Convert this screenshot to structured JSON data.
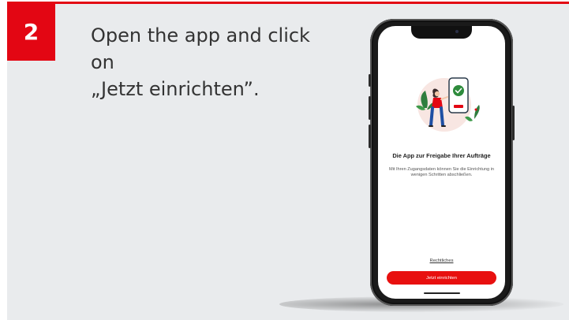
{
  "step": {
    "number": "2"
  },
  "instruction": {
    "line1": "Open the app and click on",
    "line2": "„Jetzt einrichten”."
  },
  "app_screen": {
    "title": "Die App zur Freigabe Ihrer Aufträge",
    "description": "Mit Ihren Zugangsdaten können Sie die Einrichtung in wenigen Schritten abschließen.",
    "legal_link": "Rechtliches",
    "cta_button": "Jetzt einrichten"
  },
  "colors": {
    "accent": "#e30613",
    "background": "#e9ebed",
    "text": "#333333",
    "phone_body": "#1a1a1a"
  },
  "icons": [
    "checkmark-icon",
    "phone-illustration",
    "person-illustration",
    "plant-illustration"
  ]
}
